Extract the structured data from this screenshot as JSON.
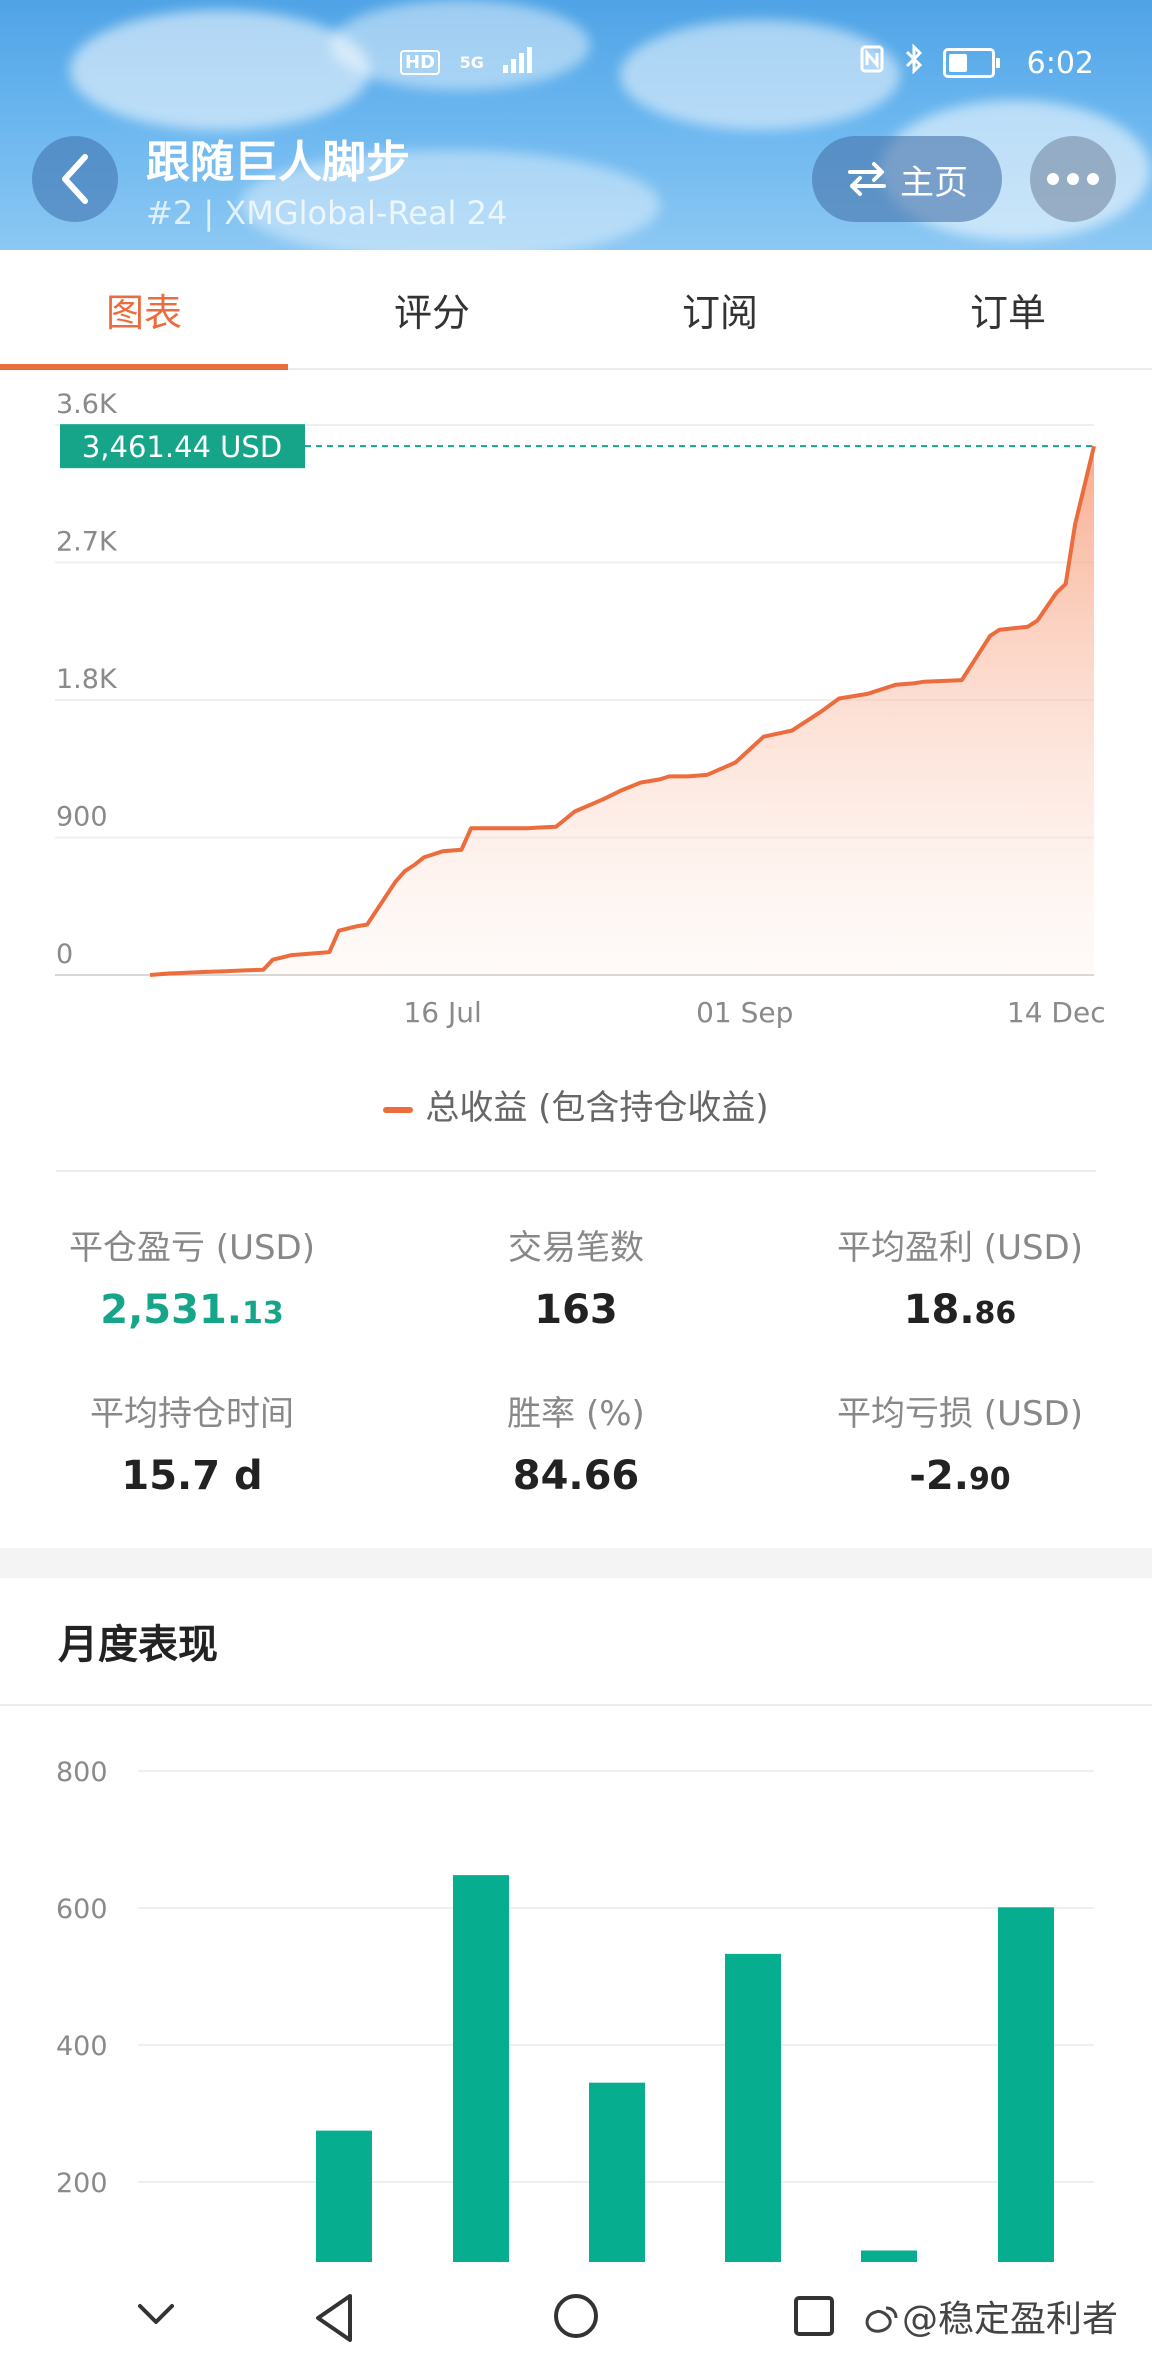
{
  "status_bar": {
    "hd": "HD",
    "network": "5G",
    "time": "6:02"
  },
  "header": {
    "title": "跟随巨人脚步",
    "subtitle": "#2 | XMGlobal-Real 24",
    "home_label": "主页"
  },
  "tabs": [
    {
      "label": "图表",
      "active": true
    },
    {
      "label": "评分",
      "active": false
    },
    {
      "label": "订阅",
      "active": false
    },
    {
      "label": "订单",
      "active": false
    }
  ],
  "equity_legend": "总收益 (包含持仓收益)",
  "stats": [
    {
      "label": "平仓盈亏 (USD)",
      "value_main": "2,531.",
      "value_small": "13"
    },
    {
      "label": "交易笔数",
      "value_main": "163",
      "value_small": ""
    },
    {
      "label": "平均盈利 (USD)",
      "value_main": "18.",
      "value_small": "86"
    },
    {
      "label": "平均持仓时间",
      "value_main": "15.7 d",
      "value_small": ""
    },
    {
      "label": "胜率 (%)",
      "value_main": "84.66",
      "value_small": ""
    },
    {
      "label": "平均亏损 (USD)",
      "value_main": "-2.",
      "value_small": "90"
    }
  ],
  "monthly_title": "月度表现",
  "watermark": "@稳定盈利者",
  "colors": {
    "accent": "#ec6c3d",
    "positive": "#17a58a",
    "bar": "#06ad8f"
  },
  "chart_data": [
    {
      "type": "area",
      "tick_labels_y": [
        "0",
        "900",
        "1.8K",
        "2.7K",
        "3.6K"
      ],
      "tick_values_y": [
        0,
        900,
        1800,
        2700,
        3600
      ],
      "tick_labels_x": [
        "16 Jul",
        "01 Sep",
        "14 Dec"
      ],
      "tick_positions_x": [
        0.31,
        0.63,
        0.96
      ],
      "ylim": [
        0,
        3600
      ],
      "current_label": "3,461.44 USD",
      "current_value": 3461.44,
      "series": [
        {
          "name": "总收益 (包含持仓收益)",
          "x": [
            0,
            0.02,
            0.06,
            0.08,
            0.1,
            0.12,
            0.13,
            0.14,
            0.15,
            0.17,
            0.19,
            0.2,
            0.22,
            0.23,
            0.26,
            0.27,
            0.28,
            0.29,
            0.31,
            0.33,
            0.34,
            0.37,
            0.4,
            0.41,
            0.43,
            0.45,
            0.48,
            0.5,
            0.52,
            0.54,
            0.55,
            0.57,
            0.59,
            0.62,
            0.65,
            0.68,
            0.7,
            0.71,
            0.73,
            0.76,
            0.78,
            0.79,
            0.81,
            0.82,
            0.86,
            0.89,
            0.9,
            0.93,
            0.94,
            0.96,
            0.97,
            0.98,
            1.0
          ],
          "y": [
            0,
            10,
            20,
            25,
            30,
            35,
            100,
            115,
            130,
            140,
            150,
            290,
            320,
            330,
            610,
            680,
            720,
            770,
            810,
            820,
            960,
            960,
            960,
            965,
            970,
            1070,
            1150,
            1210,
            1260,
            1280,
            1300,
            1300,
            1310,
            1390,
            1560,
            1600,
            1680,
            1720,
            1810,
            1840,
            1880,
            1900,
            1910,
            1920,
            1930,
            2220,
            2260,
            2280,
            2320,
            2500,
            2560,
            2950,
            3461.44
          ]
        }
      ]
    },
    {
      "type": "bar",
      "tick_labels_y": [
        "200",
        "400",
        "600",
        "800"
      ],
      "tick_values_y": [
        200,
        400,
        600,
        800
      ],
      "ylim": [
        100,
        800
      ],
      "values": [
        0,
        275,
        648,
        345,
        533,
        100,
        601
      ]
    }
  ]
}
